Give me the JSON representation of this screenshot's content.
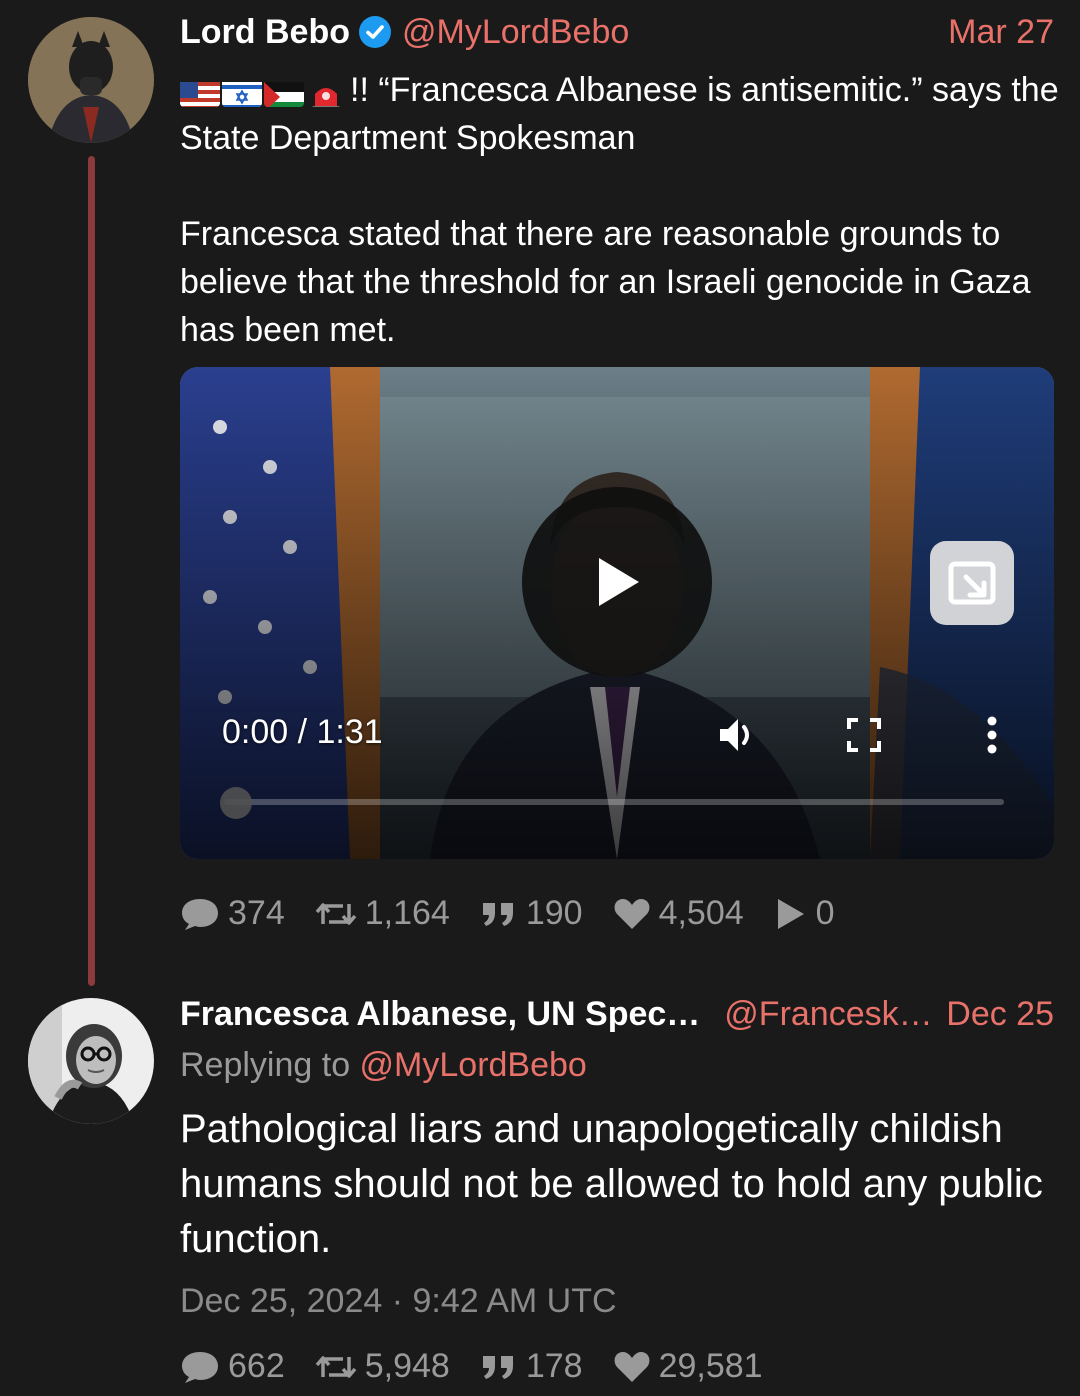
{
  "tweet1": {
    "name": "Lord Bebo",
    "handle": "@MyLordBebo",
    "date": "Mar 27",
    "flag_icons": [
      "us-flag-icon",
      "israel-flag-icon",
      "palestine-flag-icon",
      "siren-icon"
    ],
    "text_line1": "!! “Francesca Albanese is antisemitic.” says the State Department Spokesman",
    "text_para2": "Francesca stated that there are reasonable grounds to believe that the threshold for an Israeli genocide in Gaza has been met.",
    "video": {
      "time": "0:00 / 1:31",
      "progress": 0
    },
    "stats": {
      "replies": "374",
      "retweets": "1,164",
      "quotes": "190",
      "likes": "4,504",
      "plays": "0"
    }
  },
  "tweet2": {
    "name": "Francesca Albanese, UN Spec…",
    "handle": "@Francesk…",
    "date": "Dec 25",
    "replying_prefix": "Replying to ",
    "replying_handle": "@MyLordBebo",
    "text": "Pathological liars and unapologetically childish humans should not be allowed to hold any public function.",
    "timestamp": "Dec 25, 2024 · 9:42 AM UTC",
    "stats": {
      "replies": "662",
      "retweets": "5,948",
      "quotes": "178",
      "likes": "29,581"
    }
  },
  "colors": {
    "background": "#1a1a1a",
    "accent": "#e8716a",
    "muted": "#9a9a9a",
    "thread_line": "#8b3b3b",
    "verified": "#1d9bf0"
  }
}
